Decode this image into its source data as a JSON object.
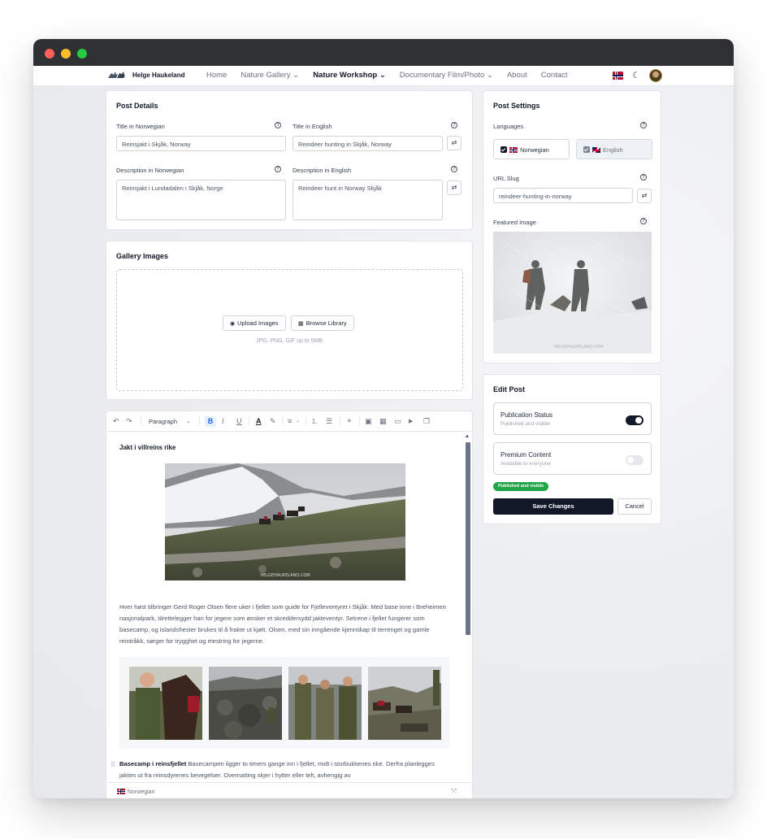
{
  "navbar": {
    "brand": "Helge Haukeland",
    "links": [
      {
        "label": "Home"
      },
      {
        "label": "Nature Gallery ⌄"
      },
      {
        "label": "Nature Workshop ⌄"
      },
      {
        "label": "Documentary Film/Photo ⌄"
      },
      {
        "label": "About"
      },
      {
        "label": "Contact"
      }
    ],
    "moon_icon": "☾"
  },
  "post_details": {
    "title": "Post Details",
    "title_no_label": "Title in Norwegian",
    "title_no_value": "Reinsjakt i Skjåk, Norway",
    "title_en_label": "Title in English",
    "title_en_value": "Reindeer hunting in Skjåk, Norway",
    "desc_no_label": "Description in Norwegian",
    "desc_no_value": "Reinsjakt i Lundadalen i Skjåk, Norge",
    "desc_en_label": "Description in English",
    "desc_en_value": "Reindeer hunt in Norway Skjåk",
    "help_glyph": "?",
    "translate_glyph": "⇄"
  },
  "gallery": {
    "title": "Gallery Images",
    "upload_label": "Upload Images",
    "browse_label": "Browse Library",
    "hint": "JPG, PNG, GIF up to 5MB",
    "upload_glyph": "◉",
    "browse_glyph": "▦"
  },
  "editor": {
    "toolbar": {
      "undo": "↶",
      "redo": "↷",
      "block_type": "Paragraph",
      "chevron": "⌄",
      "bold": "B",
      "italic": "I",
      "underline": "U",
      "text_color": "A",
      "highlight": "✎",
      "align": "≡",
      "ordered_list": "⒈",
      "bullet_list": "☰",
      "insert": "+",
      "image": "▣",
      "gallery": "▦",
      "embed": "▭",
      "video": "▶",
      "more": "❐"
    },
    "heading": "Jakt i villreins rike",
    "paragraph1": "Hver høst tilbringer Gerd Roger Olsen flere uker i fjellet som guide for Fjelleventyret i Skjåk. Med base inne i Breheimen nasjonalpark, tilrettelegger han for jegere som ønsker et skreddersydd jakteventyr. Setrene i fjellet fungerer som basecamp, og islandshester brukes til å frakte ut kjøtt. Olsen, med sin inngående kjennskap til terrenget og gamle reintråkk, sørger for trygghet og mestring for jegerne.",
    "para2_bold": "Basecamp i reinsfjellet",
    "para2_text": " Basecampen ligger to timers gange inn i fjellet, midt i storbukkenes rike. Derfra planlegges jakten ut fra reinsdyrenes bevegelser. Overnatting skjer i hytter eller telt, avhengig av",
    "watermark": "HELGEHAUKELAND.COM",
    "footer_lang": "Norwegian",
    "drag_glyph": "⠿",
    "expand_glyph": "⤧",
    "scroll_up": "▲"
  },
  "post_settings": {
    "title": "Post Settings",
    "languages_label": "Languages",
    "lang_no": "Norwegian",
    "lang_en": "English",
    "slug_label": "URL Slug",
    "slug_value": "reindeer-hunting-in-norway",
    "featured_label": "Featured Image",
    "featured_watermark": "HELGEHAUKELAND.COM"
  },
  "edit_post": {
    "title": "Edit Post",
    "pub_title": "Publication Status",
    "pub_sub": "Published and visible",
    "pub_on": true,
    "premium_title": "Premium Content",
    "premium_sub": "Available to everyone",
    "premium_on": false,
    "badge": "Published and visible",
    "save": "Save Changes",
    "cancel": "Cancel"
  },
  "colors": {
    "primary": "#111827",
    "badge_green": "#22a447",
    "accent_blue": "#2563eb"
  }
}
